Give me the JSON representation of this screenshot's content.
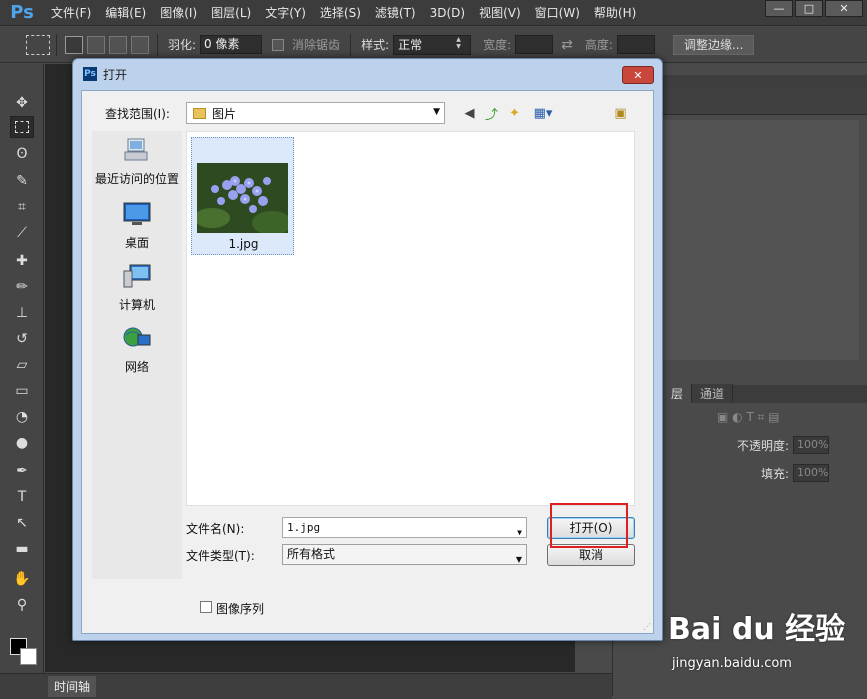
{
  "app": {
    "logo": "Ps",
    "menu": [
      "文件(F)",
      "编辑(E)",
      "图像(I)",
      "图层(L)",
      "文字(Y)",
      "选择(S)",
      "滤镜(T)",
      "3D(D)",
      "视图(V)",
      "窗口(W)",
      "帮助(H)"
    ],
    "window_buttons": [
      "—",
      "□",
      "✕"
    ]
  },
  "options": {
    "feather_label": "羽化:",
    "feather_value": "0 像素",
    "antialias_label": "消除锯齿",
    "style_label": "样式:",
    "style_value": "正常",
    "width_label": "宽度:",
    "height_label": "高度:",
    "refine_edge_label": "调整边缘..."
  },
  "panels": {
    "layers_tab": "层",
    "channels_tab": "通道",
    "opacity_label": "不透明度:",
    "opacity_value": "100%",
    "fill_label": "填充:",
    "fill_value": "100%"
  },
  "timeline": {
    "tab_label": "时间轴"
  },
  "dialog": {
    "title": "打开",
    "look_in_label": "查找范围(I):",
    "look_in_value": "图片",
    "places": [
      "最近访问的位置",
      "桌面",
      "计算机",
      "网络"
    ],
    "files": [
      {
        "name": "1.jpg"
      }
    ],
    "file_name_label": "文件名(N):",
    "file_name_value": "1.jpg",
    "file_type_label": "文件类型(T):",
    "file_type_value": "所有格式",
    "open_button": "打开(O)",
    "cancel_button": "取消",
    "image_sequence_label": "图像序列",
    "image_sequence_checked": false
  },
  "watermark": {
    "main": "Bai du 经验",
    "url": "jingyan.baidu.com"
  },
  "colors": {
    "highlight": "#e02020",
    "dialog_frame": "#bcd2ec",
    "ps_blue": "#4fa3e8"
  }
}
